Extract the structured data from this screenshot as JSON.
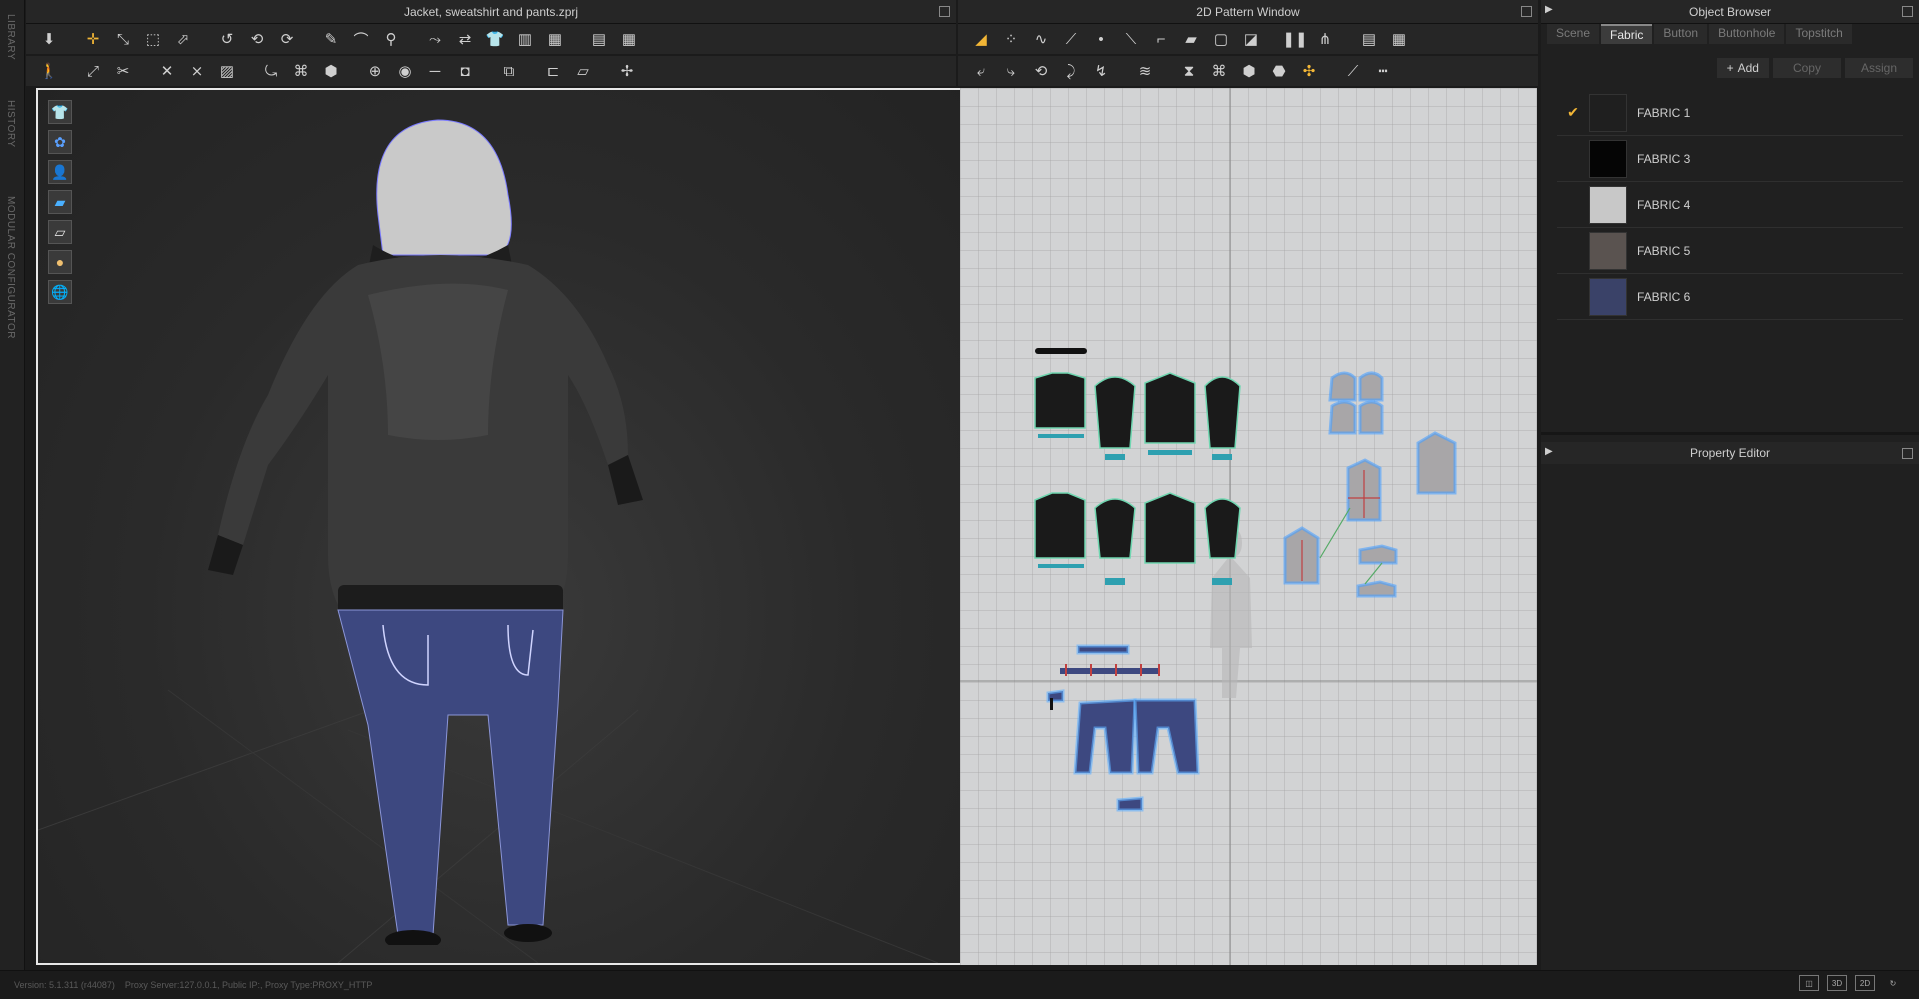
{
  "left_rail": {
    "labels": [
      "LIBRARY",
      "HISTORY",
      "MODULAR CONFIGURATOR"
    ]
  },
  "window_3d": {
    "title": "Jacket, sweatshirt and pants.zprj",
    "toolbar_row1": [
      "arrow-down-icon",
      "move-icon",
      "select-mesh-icon",
      "bounding-box-icon",
      "edit-points-icon",
      "rotate-icon",
      "transform-icon",
      "fold-icon",
      "pen-icon",
      "sew-icon",
      "pin-icon",
      "stitch-icon",
      "arrange-icon",
      "tshirt-icon",
      "shirt-icon",
      "pattern-icon",
      "grid-icon"
    ],
    "toolbar_row2": [
      "avatar-icon",
      "measure-icon",
      "tape-icon",
      "edit-avatar-icon",
      "fit-icon",
      "garment-icon",
      "flip-icon",
      "seam-icon",
      "fabric-icon",
      "button-icon",
      "circle-icon",
      "line-icon",
      "stamp-icon",
      "zipper-icon",
      "ruler-icon",
      "plane-icon",
      "tuck-icon"
    ],
    "side_tools": [
      "tshirt-view-icon",
      "gather-icon",
      "avatar-view-icon",
      "texture-icon",
      "paper-icon",
      "skin-icon",
      "globe-icon"
    ]
  },
  "window_2d": {
    "title": "2D Pattern Window",
    "toolbar_row1": [
      "trace-icon",
      "select-icon",
      "curve-icon",
      "polygon-icon",
      "point-icon",
      "segment-icon",
      "line-icon",
      "fold-icon",
      "internal-shape-icon",
      "rectangle-icon",
      "ellipse-icon",
      "dart-icon",
      "pleat-icon",
      "grid-icon"
    ],
    "toolbar_row2": [
      "edit-pattern-icon",
      "move-icon",
      "trace-line-icon",
      "fold-arrangement-icon",
      "sew-icon",
      "hand-icon",
      "edit-sewing-icon",
      "free-sew-icon",
      "check-icon",
      "pin-icon",
      "style-line-icon",
      "topstitch-icon"
    ]
  },
  "object_browser": {
    "title": "Object Browser",
    "tabs": [
      "Scene",
      "Fabric",
      "Button",
      "Buttonhole",
      "Topstitch"
    ],
    "active_tab": "Fabric",
    "buttons": {
      "add": "Add",
      "copy": "Copy",
      "assign": "Assign"
    },
    "fabrics": [
      {
        "name": "FABRIC 1",
        "color": "#1f1f1f",
        "checked": true
      },
      {
        "name": "FABRIC 3",
        "color": "#050505",
        "checked": false
      },
      {
        "name": "FABRIC 4",
        "color": "#c8c8c8",
        "checked": false
      },
      {
        "name": "FABRIC 5",
        "color": "#5a5350",
        "checked": false
      },
      {
        "name": "FABRIC 6",
        "color": "#3a4268",
        "checked": false
      }
    ]
  },
  "property_editor": {
    "title": "Property Editor"
  },
  "status_bar": {
    "version": "Version: 5.1.311 (r44087)",
    "proxy": "Proxy Server:127.0.0.1, Public IP:, Proxy Type:PROXY_HTTP"
  }
}
